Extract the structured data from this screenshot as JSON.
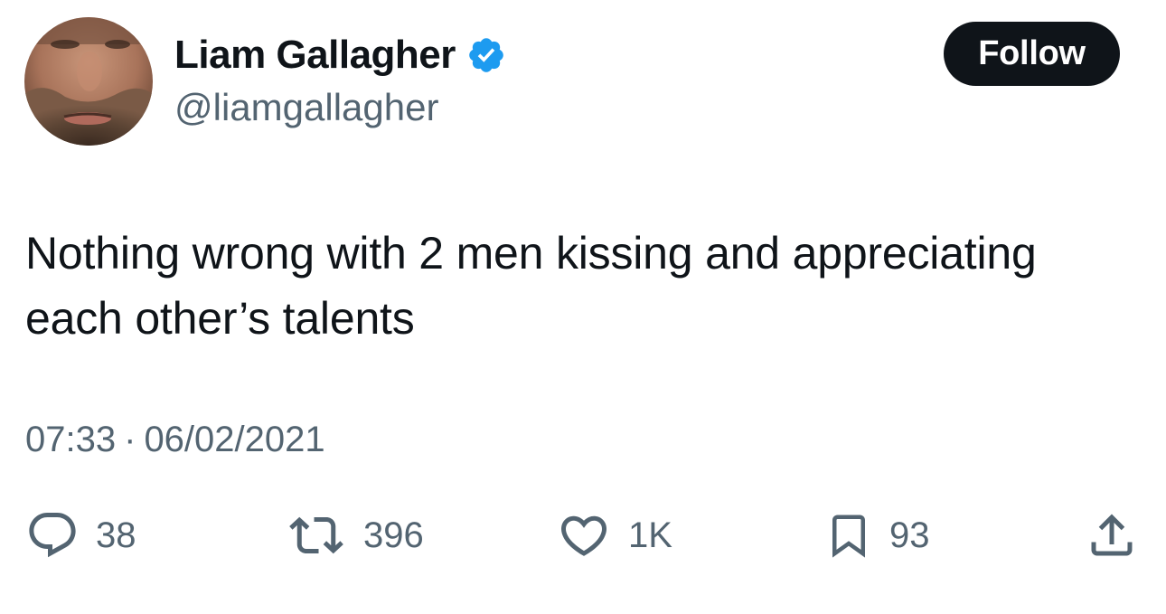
{
  "author": {
    "display_name": "Liam Gallagher",
    "handle": "@liamgallagher",
    "verified": true
  },
  "follow_button": {
    "label": "Follow"
  },
  "tweet": {
    "text_line1": "Nothing wrong with 2 men kissing and appreciating",
    "text_line2": "each other’s talents",
    "time": "07:33",
    "separator": "·",
    "date": "06/02/2021"
  },
  "actions": {
    "replies": "38",
    "retweets": "396",
    "likes": "1K",
    "bookmarks": "93"
  },
  "icons": {
    "verified": "verified-badge-icon",
    "reply": "reply-icon",
    "retweet": "retweet-icon",
    "like": "heart-icon",
    "bookmark": "bookmark-icon",
    "share": "share-icon"
  },
  "colors": {
    "text_primary": "#0f1419",
    "text_secondary": "#536471",
    "verified_blue": "#1d9bf0",
    "follow_bg": "#0f1419"
  }
}
